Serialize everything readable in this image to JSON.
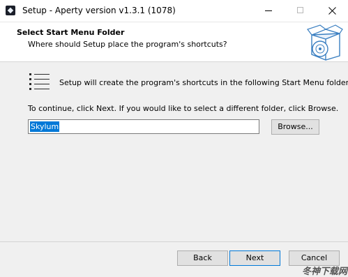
{
  "window": {
    "title": "Setup - Aperty version v1.3.1 (1078)"
  },
  "header": {
    "title": "Select Start Menu Folder",
    "subtitle": "Where should Setup place the program's shortcuts?"
  },
  "main": {
    "info_text": "Setup will create the program's shortcuts in the following Start Menu folder.",
    "continue_text": "To continue, click Next. If you would like to select a different folder, click Browse.",
    "folder_value": "Skylum",
    "browse_label": "Browse..."
  },
  "footer": {
    "back_label": "Back",
    "next_label": "Next",
    "cancel_label": "Cancel"
  },
  "watermark": "冬神下载网",
  "icons": {
    "app": "app-icon",
    "header": "box-cd-icon",
    "list": "start-menu-list-icon",
    "close": "close-icon",
    "minimize": "minimize-icon",
    "maximize": "maximize-icon"
  },
  "colors": {
    "selection": "#0078d7",
    "button_face": "#e1e1e1",
    "header_bg": "#ffffff",
    "window_bg": "#f0f0f0"
  }
}
